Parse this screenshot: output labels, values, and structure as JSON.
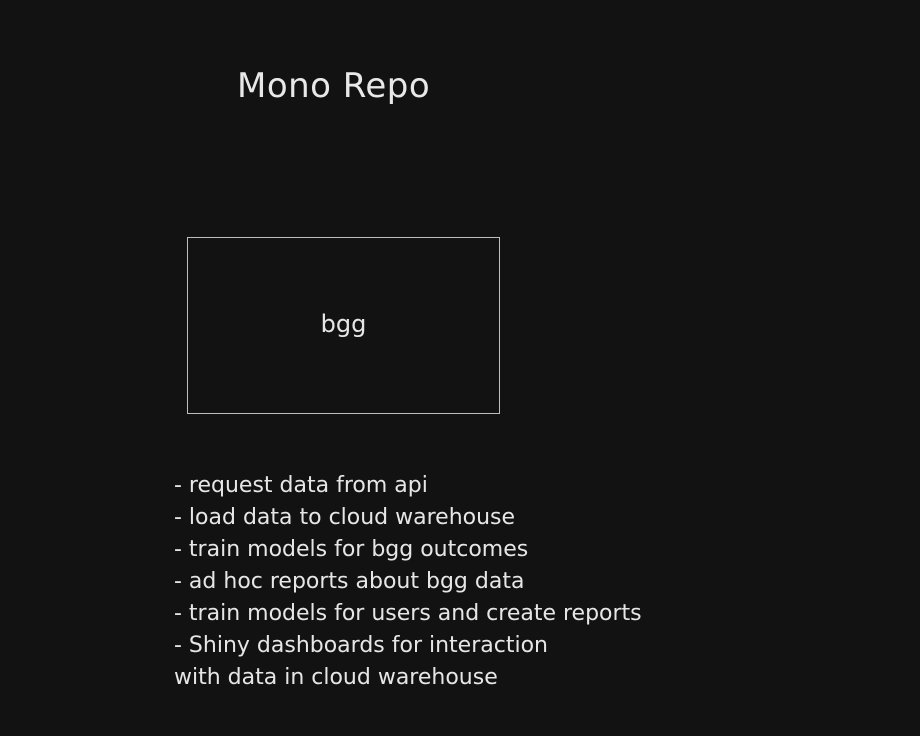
{
  "diagram": {
    "title": "Mono Repo",
    "box_label": "bgg",
    "notes": [
      "- request data from api",
      "- load data to cloud warehouse",
      "- train models for bgg outcomes",
      "- ad hoc reports about bgg data",
      "- train models for users and create reports",
      "- Shiny dashboards for interaction",
      "with data in cloud warehouse"
    ]
  }
}
